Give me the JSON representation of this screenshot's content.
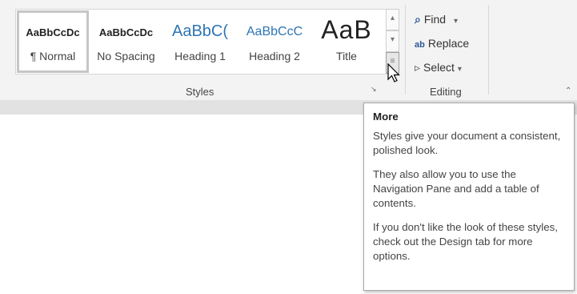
{
  "styles_gallery": {
    "tiles": [
      {
        "preview": "AaBbCcDc",
        "name": "¶ Normal",
        "selected": true
      },
      {
        "preview": "AaBbCcDc",
        "name": "No Spacing",
        "selected": false
      },
      {
        "preview": "AaBbC(",
        "name": "Heading 1",
        "selected": false
      },
      {
        "preview": "AaBbCcC",
        "name": "Heading 2",
        "selected": false
      },
      {
        "preview": "AaB",
        "name": "Title",
        "selected": false
      }
    ],
    "scroll_up_icon": "▴",
    "scroll_down_icon": "▾",
    "more_icon": "≡",
    "group_label": "Styles",
    "launcher_icon": "↘"
  },
  "editing": {
    "find_label": "Find",
    "find_caret": "▾",
    "replace_label": "Replace",
    "select_label": "Select",
    "select_caret": "▾",
    "group_label": "Editing",
    "find_icon": "⌕",
    "replace_icon": "ab",
    "select_icon": "▹"
  },
  "collapse_icon": "⌃",
  "tooltip": {
    "title": "More",
    "p1": "Styles give your document a consistent, polished look.",
    "p2": "They also allow you to use the Navigation Pane and add a table of contents.",
    "p3": "If you don't like the look of these styles, check out the Design tab for more options."
  },
  "colors": {
    "heading_blue": "#2e74b5",
    "icon_blue": "#2b5797",
    "ribbon_bg": "#f3f3f3"
  }
}
